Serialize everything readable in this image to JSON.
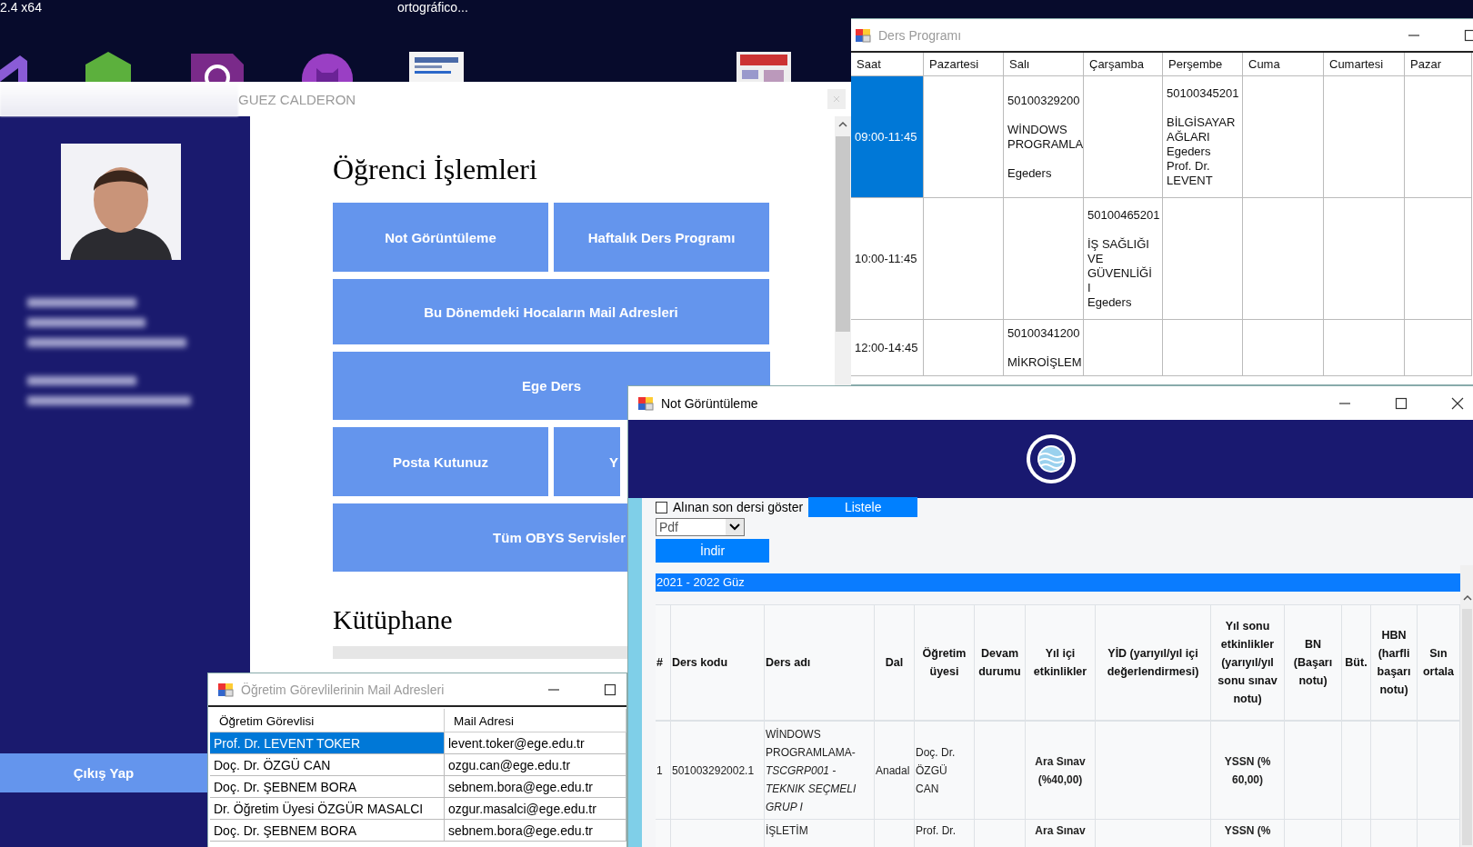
{
  "desktop": {
    "labels": [
      "2.4 x64",
      "ortográfico..."
    ]
  },
  "schedule_window": {
    "title": "Ders Programı",
    "columns": [
      "Saat",
      "Pazartesi",
      "Salı",
      "Çarşamba",
      "Perşembe",
      "Cuma",
      "Cumartesi",
      "Pazar"
    ],
    "rows": [
      {
        "time": "09:00-11:45",
        "selected": true,
        "cells": {
          "tue": "50100329200\n\nWİNDOWS\nPROGRAMLA\n\nEgeders",
          "thu": "50100345201\n\nBİLGİSAYAR\nAĞLARI\nEgeders\nProf. Dr.\nLEVENT"
        }
      },
      {
        "time": "10:00-11:45",
        "selected": false,
        "cells": {
          "wed": "50100465201\n\nİŞ SAĞLIĞI\nVE\nGÜVENLİĞİ\nI\nEgeders"
        }
      },
      {
        "time": "12:00-14:45",
        "selected": false,
        "cells": {
          "tue": "50100341200\n\nMİKROİŞLEM"
        }
      }
    ]
  },
  "main_window": {
    "title": "GUEZ CALDERON",
    "heading": "Öğrenci İşlemleri",
    "button_rows": [
      [
        "Not Görüntüleme",
        "Haftalık Ders Programı"
      ],
      [
        "Bu Dönemdeki Hocaların Mail Adresleri"
      ],
      [
        "Ege Ders"
      ],
      [
        "Posta Kutunuz",
        "Y"
      ],
      [
        "Tüm OBYS Servisler"
      ]
    ],
    "section_heading": "Kütüphane",
    "logout_button": "Çıkış Yap"
  },
  "mail_window": {
    "title": "Öğretim Görevlilerinin Mail Adresleri",
    "columns": [
      "Öğretim Görevlisi",
      "Mail Adresi"
    ],
    "rows": [
      {
        "teacher": "Prof. Dr.  LEVENT TOKER",
        "mail": "levent.toker@ege.edu.tr",
        "selected": true
      },
      {
        "teacher": "Doç. Dr. ÖZGÜ CAN",
        "mail": "ozgu.can@ege.edu.tr",
        "selected": false
      },
      {
        "teacher": "Doç. Dr. ŞEBNEM BORA",
        "mail": "sebnem.bora@ege.edu.tr",
        "selected": false
      },
      {
        "teacher": "Dr. Öğretim Üyesi ÖZGÜR MASALCI",
        "mail": "ozgur.masalci@ege.edu.tr",
        "selected": false
      },
      {
        "teacher": "Doç. Dr. ŞEBNEM BORA",
        "mail": "sebnem.bora@ege.edu.tr",
        "selected": false
      }
    ]
  },
  "grades_window": {
    "title": "Not Görüntüleme",
    "checkbox": {
      "label": "Alınan son dersi göster",
      "checked": false
    },
    "list_button": "Listele",
    "format_select": {
      "value": "Pdf"
    },
    "download_button": "İndir",
    "term": "2021 - 2022 Güz",
    "columns": [
      "#",
      "Ders kodu",
      "Ders adı",
      "Dal",
      "Öğretim üyesi",
      "Devam durumu",
      "Yıl içi etkinlikler",
      "YİD (yarıyıl/yıl içi değerlendirmesi)",
      "Yıl sonu etkinlikler (yarıyıl/yıl sonu sınav notu)",
      "BN (Başarı notu)",
      "Büt.",
      "HBN (harfli başarı notu)",
      "Sın ortala"
    ],
    "rows": [
      {
        "num": "1",
        "code": "501003292002.1",
        "name": "WİNDOWS PROGRAMLAMA-*TSCGRP001 - TEKNIK SEÇMELI GRUP I*",
        "dal": "Anadal",
        "teacher": "Doç. Dr. ÖZGÜ CAN",
        "yil_ici": "Ara Sınav (%40,00)",
        "yil_sonu": "YSSN (% 60,00)"
      },
      {
        "name": "İŞLETİM",
        "teacher": "Prof. Dr.",
        "yil_ici": "Ara Sınav",
        "yil_sonu": "YSSN (%"
      }
    ]
  }
}
